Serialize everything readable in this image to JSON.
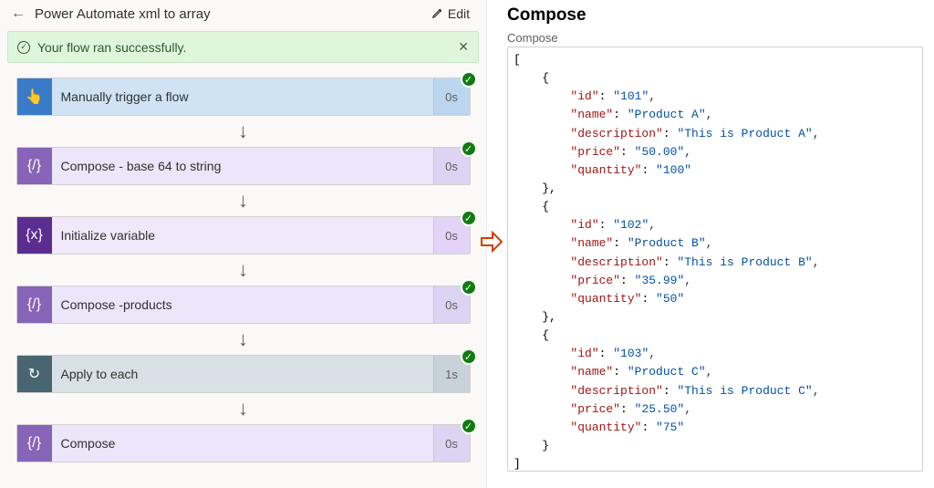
{
  "header": {
    "title": "Power Automate xml to array",
    "edit_label": "Edit"
  },
  "status_bar": {
    "text": "Your flow ran successfully."
  },
  "steps": [
    {
      "type": "trigger",
      "icon": "👆",
      "label": "Manually trigger a flow",
      "duration": "0s"
    },
    {
      "type": "compose",
      "icon": "{/}",
      "label": "Compose - base 64 to string",
      "duration": "0s"
    },
    {
      "type": "initvar",
      "icon": "{x}",
      "label": "Initialize variable",
      "duration": "0s"
    },
    {
      "type": "compose",
      "icon": "{/}",
      "label": "Compose -products",
      "duration": "0s"
    },
    {
      "type": "apply",
      "icon": "↻",
      "label": "Apply to each",
      "duration": "1s"
    },
    {
      "type": "compose",
      "icon": "{/}",
      "label": "Compose",
      "duration": "0s"
    }
  ],
  "right_panel": {
    "title": "Compose",
    "subtitle": "Compose",
    "json_output": [
      {
        "id": "101",
        "name": "Product A",
        "description": "This is Product A",
        "price": "50.00",
        "quantity": "100"
      },
      {
        "id": "102",
        "name": "Product B",
        "description": "This is Product B",
        "price": "35.99",
        "quantity": "50"
      },
      {
        "id": "103",
        "name": "Product C",
        "description": "This is Product C",
        "price": "25.50",
        "quantity": "75"
      }
    ]
  }
}
